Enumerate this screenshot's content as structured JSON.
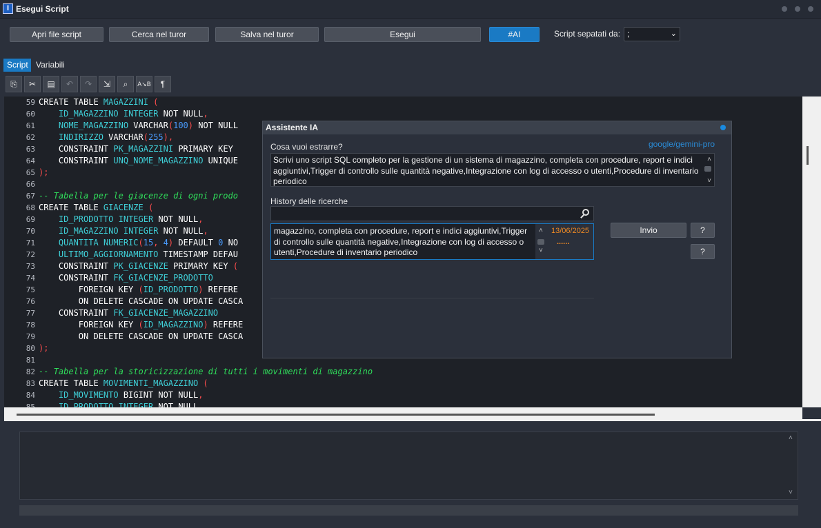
{
  "window": {
    "title": "Esegui Script",
    "app_icon": "I"
  },
  "toolbar": {
    "open_label": "Apri file script",
    "search_label": "Cerca nel turor",
    "save_label": "Salva nel turor",
    "run_label": "Esegui",
    "ai_label": "#AI",
    "separator_label": "Script sepatati da:",
    "separator_value": ";"
  },
  "tabs": {
    "script": "Script",
    "variables": "Variabili"
  },
  "editor_tools": [
    {
      "icon": "copy-icon",
      "glyph": "⎘"
    },
    {
      "icon": "cut-icon",
      "glyph": "✂"
    },
    {
      "icon": "paste-icon",
      "glyph": "📋"
    },
    {
      "icon": "undo-icon",
      "glyph": "↶"
    },
    {
      "icon": "redo-icon",
      "glyph": "↷"
    },
    {
      "icon": "select-icon",
      "glyph": "⇲"
    },
    {
      "icon": "find-icon",
      "glyph": "⌕"
    },
    {
      "icon": "replace-icon",
      "glyph": "ᴬʙ"
    },
    {
      "icon": "paragraph-icon",
      "glyph": "¶"
    }
  ],
  "editor_lines": [
    {
      "n": "59",
      "t": [
        [
          "kw",
          "CREATE TABLE "
        ],
        [
          "id",
          "MAGAZZINI"
        ],
        [
          "pn",
          " ("
        ]
      ]
    },
    {
      "n": "60",
      "t": [
        [
          "plain",
          "    "
        ],
        [
          "id",
          "ID_MAGAZZINO"
        ],
        [
          "plain",
          " "
        ],
        [
          "id",
          "INTEGER"
        ],
        [
          "kw",
          " NOT NULL"
        ],
        [
          "pn",
          ","
        ]
      ]
    },
    {
      "n": "61",
      "t": [
        [
          "plain",
          "    "
        ],
        [
          "id",
          "NOME_MAGAZZINO"
        ],
        [
          "kw",
          " VARCHAR"
        ],
        [
          "pn",
          "("
        ],
        [
          "num",
          "100"
        ],
        [
          "pn",
          ")"
        ],
        [
          "kw",
          " NOT NULL"
        ]
      ]
    },
    {
      "n": "62",
      "t": [
        [
          "plain",
          "    "
        ],
        [
          "id",
          "INDIRIZZO"
        ],
        [
          "kw",
          " VARCHAR"
        ],
        [
          "pn",
          "("
        ],
        [
          "num",
          "255"
        ],
        [
          "pn",
          "),"
        ]
      ]
    },
    {
      "n": "63",
      "t": [
        [
          "plain",
          "    "
        ],
        [
          "kw",
          "CONSTRAINT "
        ],
        [
          "id",
          "PK_MAGAZZINI"
        ],
        [
          "kw",
          " PRIMARY KEY"
        ]
      ]
    },
    {
      "n": "64",
      "t": [
        [
          "plain",
          "    "
        ],
        [
          "kw",
          "CONSTRAINT "
        ],
        [
          "id",
          "UNQ_NOME_MAGAZZINO"
        ],
        [
          "kw",
          " UNIQUE"
        ]
      ]
    },
    {
      "n": "65",
      "t": [
        [
          "pn",
          ");"
        ]
      ]
    },
    {
      "n": "66",
      "t": []
    },
    {
      "n": "67",
      "t": [
        [
          "cm",
          "-- Tabella per le giacenze di ogni prodo"
        ]
      ]
    },
    {
      "n": "68",
      "t": [
        [
          "kw",
          "CREATE TABLE "
        ],
        [
          "id",
          "GIACENZE"
        ],
        [
          "pn",
          " ("
        ]
      ]
    },
    {
      "n": "69",
      "t": [
        [
          "plain",
          "    "
        ],
        [
          "id",
          "ID_PRODOTTO"
        ],
        [
          "plain",
          " "
        ],
        [
          "id",
          "INTEGER"
        ],
        [
          "kw",
          " NOT NULL"
        ],
        [
          "pn",
          ","
        ]
      ]
    },
    {
      "n": "70",
      "t": [
        [
          "plain",
          "    "
        ],
        [
          "id",
          "ID_MAGAZZINO"
        ],
        [
          "plain",
          " "
        ],
        [
          "id",
          "INTEGER"
        ],
        [
          "kw",
          " NOT NULL"
        ],
        [
          "pn",
          ","
        ]
      ]
    },
    {
      "n": "71",
      "t": [
        [
          "plain",
          "    "
        ],
        [
          "id",
          "QUANTITA"
        ],
        [
          "plain",
          " "
        ],
        [
          "id",
          "NUMERIC"
        ],
        [
          "pn",
          "("
        ],
        [
          "num",
          "15"
        ],
        [
          "pn",
          ", "
        ],
        [
          "num",
          "4"
        ],
        [
          "pn",
          ")"
        ],
        [
          "kw",
          " DEFAULT "
        ],
        [
          "num",
          "0"
        ],
        [
          "kw",
          " NO"
        ]
      ]
    },
    {
      "n": "72",
      "t": [
        [
          "plain",
          "    "
        ],
        [
          "id",
          "ULTIMO_AGGIORNAMENTO"
        ],
        [
          "kw",
          " TIMESTAMP DEFAU"
        ]
      ]
    },
    {
      "n": "73",
      "t": [
        [
          "plain",
          "    "
        ],
        [
          "kw",
          "CONSTRAINT "
        ],
        [
          "id",
          "PK_GIACENZE"
        ],
        [
          "kw",
          " PRIMARY KEY "
        ],
        [
          "pn",
          "("
        ]
      ]
    },
    {
      "n": "74",
      "t": [
        [
          "plain",
          "    "
        ],
        [
          "kw",
          "CONSTRAINT "
        ],
        [
          "id",
          "FK_GIACENZE_PRODOTTO"
        ]
      ]
    },
    {
      "n": "75",
      "t": [
        [
          "plain",
          "        "
        ],
        [
          "kw",
          "FOREIGN KEY "
        ],
        [
          "pn",
          "("
        ],
        [
          "id",
          "ID_PRODOTTO"
        ],
        [
          "pn",
          ")"
        ],
        [
          "kw",
          " REFERE"
        ]
      ]
    },
    {
      "n": "76",
      "t": [
        [
          "plain",
          "        "
        ],
        [
          "kw",
          "ON DELETE CASCADE ON UPDATE CASCA"
        ]
      ]
    },
    {
      "n": "77",
      "t": [
        [
          "plain",
          "    "
        ],
        [
          "kw",
          "CONSTRAINT "
        ],
        [
          "id",
          "FK_GIACENZE_MAGAZZINO"
        ]
      ]
    },
    {
      "n": "78",
      "t": [
        [
          "plain",
          "        "
        ],
        [
          "kw",
          "FOREIGN KEY "
        ],
        [
          "pn",
          "("
        ],
        [
          "id",
          "ID_MAGAZZINO"
        ],
        [
          "pn",
          ")"
        ],
        [
          "kw",
          " REFERE"
        ]
      ]
    },
    {
      "n": "79",
      "t": [
        [
          "plain",
          "        "
        ],
        [
          "kw",
          "ON DELETE CASCADE ON UPDATE CASCA"
        ]
      ]
    },
    {
      "n": "80",
      "t": [
        [
          "pn",
          ");"
        ]
      ]
    },
    {
      "n": "81",
      "t": []
    },
    {
      "n": "82",
      "t": [
        [
          "cm",
          "-- Tabella per la storicizzazione di tutti i movimenti di magazzino"
        ]
      ]
    },
    {
      "n": "83",
      "t": [
        [
          "kw",
          "CREATE TABLE "
        ],
        [
          "id",
          "MOVIMENTI_MAGAZZINO"
        ],
        [
          "pn",
          " ("
        ]
      ]
    },
    {
      "n": "84",
      "t": [
        [
          "plain",
          "    "
        ],
        [
          "id",
          "ID_MOVIMENTO"
        ],
        [
          "kw",
          " BIGINT NOT NULL"
        ],
        [
          "pn",
          ","
        ]
      ]
    },
    {
      "n": "85",
      "t": [
        [
          "plain",
          "    "
        ],
        [
          "id",
          "ID_PRODOTTO"
        ],
        [
          "plain",
          " "
        ],
        [
          "id",
          "INTEGER"
        ],
        [
          "kw",
          " NOT NULL"
        ]
      ]
    }
  ],
  "dialog": {
    "title": "Assistente IA",
    "question_label": "Cosa vuoi estrarre?",
    "model": "google/gemini-pro",
    "prompt": "Scrivi uno script SQL completo per la gestione di un sistema di magazzino, completa con procedure, report e indici aggiuntivi,Trigger di controllo sulle quantità negative,Integrazione con log di accesso o utenti,Procedure di inventario periodico",
    "history_label": "History delle ricerche",
    "search_placeholder": "",
    "history_item_text": "magazzino, completa con procedure, report e indici aggiuntivi,Trigger di controllo sulle quantità negative,Integrazione con log di accesso o utenti,Procedure di inventario periodico",
    "history_item_date": "13/06/2025",
    "history_item_more": "......",
    "send_label": "Invio",
    "help_label_1": "?",
    "help_label_2": "?"
  },
  "colors": {
    "accent": "#1a7ac4",
    "identifier": "#3fd0d8",
    "comment": "#2fdc5a",
    "punct": "#ff4d4d",
    "number": "#4a9cff",
    "date": "#f08a24"
  }
}
